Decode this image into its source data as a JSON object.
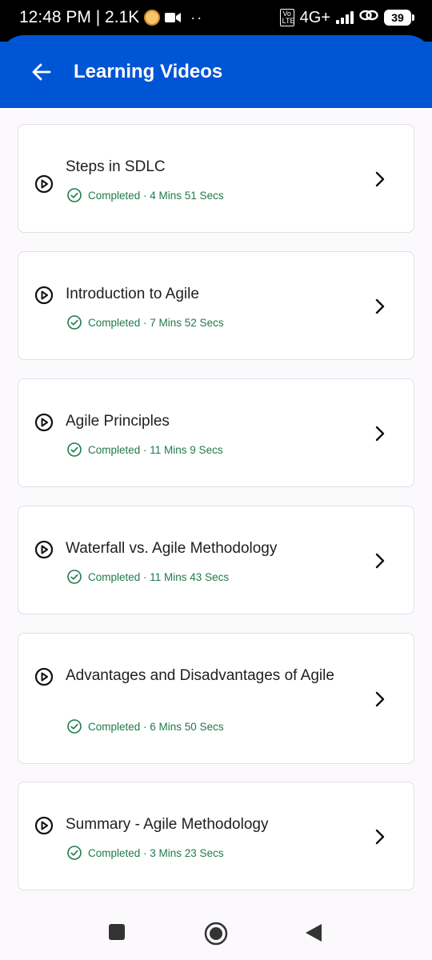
{
  "status_bar": {
    "time_text": "12:48 PM | 2.1K",
    "network": "4G+",
    "volte": "Vo LTE",
    "battery": "39"
  },
  "app_bar": {
    "title": "Learning Videos",
    "back_icon": "arrow-left-icon"
  },
  "colors": {
    "primary": "#0055d4",
    "completed": "#1e7a4c",
    "background": "#fbf9fc"
  },
  "videos": [
    {
      "title": "Steps in SDLC",
      "status": "Completed · 4 Mins 51 Secs"
    },
    {
      "title": "Introduction to Agile",
      "status": "Completed · 7 Mins 52 Secs"
    },
    {
      "title": "Agile Principles",
      "status": "Completed · 11 Mins 9 Secs"
    },
    {
      "title": "Waterfall vs. Agile Methodology",
      "status": "Completed · 11 Mins 43 Secs"
    },
    {
      "title": "Advantages and Disadvantages of Agile",
      "status": "Completed · 6 Mins 50 Secs"
    },
    {
      "title": "Summary - Agile Methodology",
      "status": "Completed · 3 Mins 23 Secs"
    }
  ],
  "nav_bar": {
    "recents_icon": "square-icon",
    "home_icon": "circle-home-icon",
    "back_icon": "triangle-back-icon"
  }
}
